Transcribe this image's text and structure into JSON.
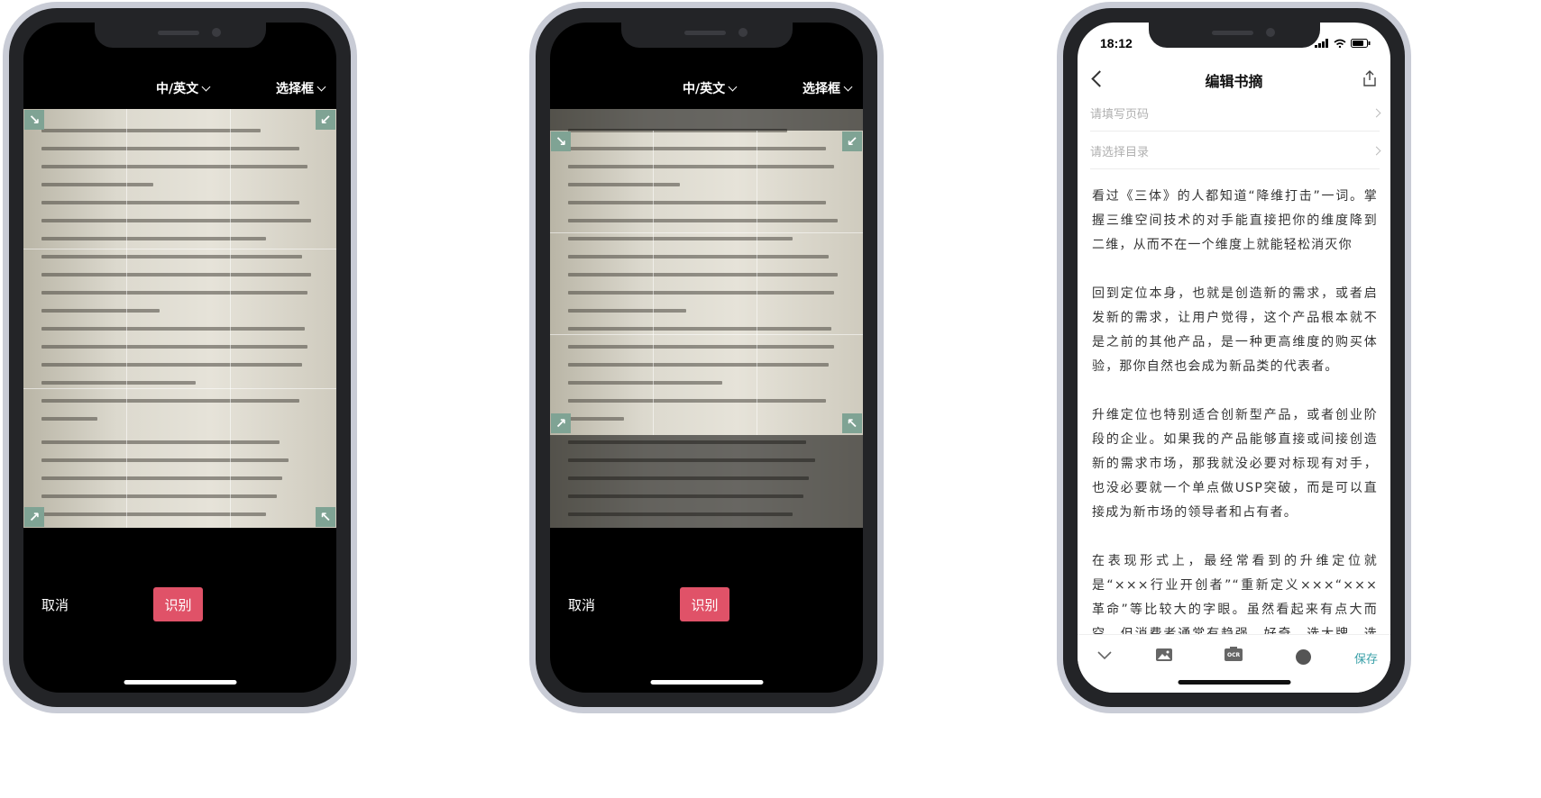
{
  "scanner_left": {
    "language_selector": "中/英文",
    "frame_selector": "选择框",
    "cancel_label": "取消",
    "recognize_label": "识别"
  },
  "scanner_middle": {
    "language_selector": "中/英文",
    "frame_selector": "选择框",
    "cancel_label": "取消",
    "recognize_label": "识别"
  },
  "editor": {
    "status_time": "18:12",
    "title": "编辑书摘",
    "page_placeholder": "请填写页码",
    "catalog_placeholder": "请选择目录",
    "paragraphs": [
      "看过《三体》的人都知道“降维打击”一词。掌握三维空间技术的对手能直接把你的维度降到二维，从而不在一个维度上就能轻松消灭你",
      "回到定位本身，也就是创造新的需求，或者启发新的需求，让用户觉得，这个产品根本就不是之前的其他产品，是一种更高维度的购买体验，那你自然也会成为新品类的代表者。",
      "升维定位也特别适合创新型产品，或者创业阶段的企业。如果我的产品能够直接或间接创造新的需求市场，那我就没必要对标现有对手，也没必要就一个单点做USP突破，而是可以直接成为新市场的领导者和占有者。",
      "在表现形式上，最经常看到的升维定位就是“×××行业开创者”“重新定义×××“×××革命”等比较大的字眼。虽然看起来有点大而空，但消费者通常有趋强、好奇、选大牌、选更先进产品的心理，所以也会产生实际效果。"
    ],
    "save_label": "保存",
    "ocr_badge": "OCR"
  }
}
